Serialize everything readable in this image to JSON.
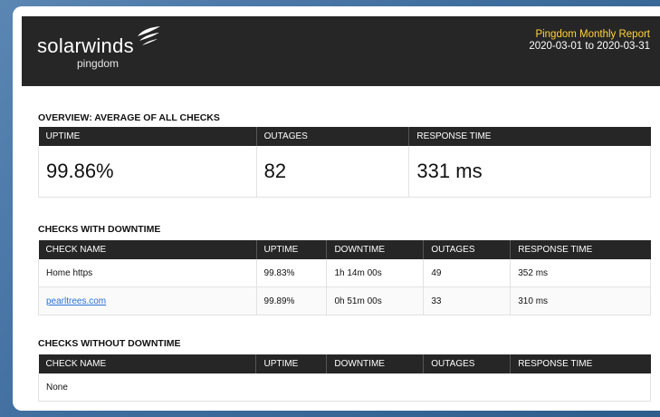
{
  "brand": {
    "wordmark": "solarwinds",
    "sub": "pingdom"
  },
  "report": {
    "title": "Pingdom Monthly Report",
    "date_range": "2020-03-01 to 2020-03-31"
  },
  "overview": {
    "title": "OVERVIEW: AVERAGE OF ALL CHECKS",
    "headers": [
      "UPTIME",
      "OUTAGES",
      "RESPONSE TIME"
    ],
    "values": [
      "99.86%",
      "82",
      "331 ms"
    ]
  },
  "with_downtime": {
    "title": "CHECKS WITH DOWNTIME",
    "headers": [
      "CHECK NAME",
      "UPTIME",
      "DOWNTIME",
      "OUTAGES",
      "RESPONSE TIME"
    ],
    "rows": [
      {
        "name": "Home https",
        "uptime": "99.83%",
        "downtime": "1h 14m 00s",
        "outages": "49",
        "response": "352 ms"
      },
      {
        "name": "pearltrees.com",
        "uptime": "99.89%",
        "downtime": "0h 51m 00s",
        "outages": "33",
        "response": "310 ms"
      }
    ]
  },
  "without_downtime": {
    "title": "CHECKS WITHOUT DOWNTIME",
    "headers": [
      "CHECK NAME",
      "UPTIME",
      "DOWNTIME",
      "OUTAGES",
      "RESPONSE TIME"
    ],
    "empty_text": "None"
  },
  "colors": {
    "header_bg": "#262626",
    "report_title": "#ffd43a",
    "outage_red": "#e04040",
    "link_blue": "#2a6fd6"
  },
  "icons": {
    "logo_mark": "solarwinds-flame-icon"
  }
}
